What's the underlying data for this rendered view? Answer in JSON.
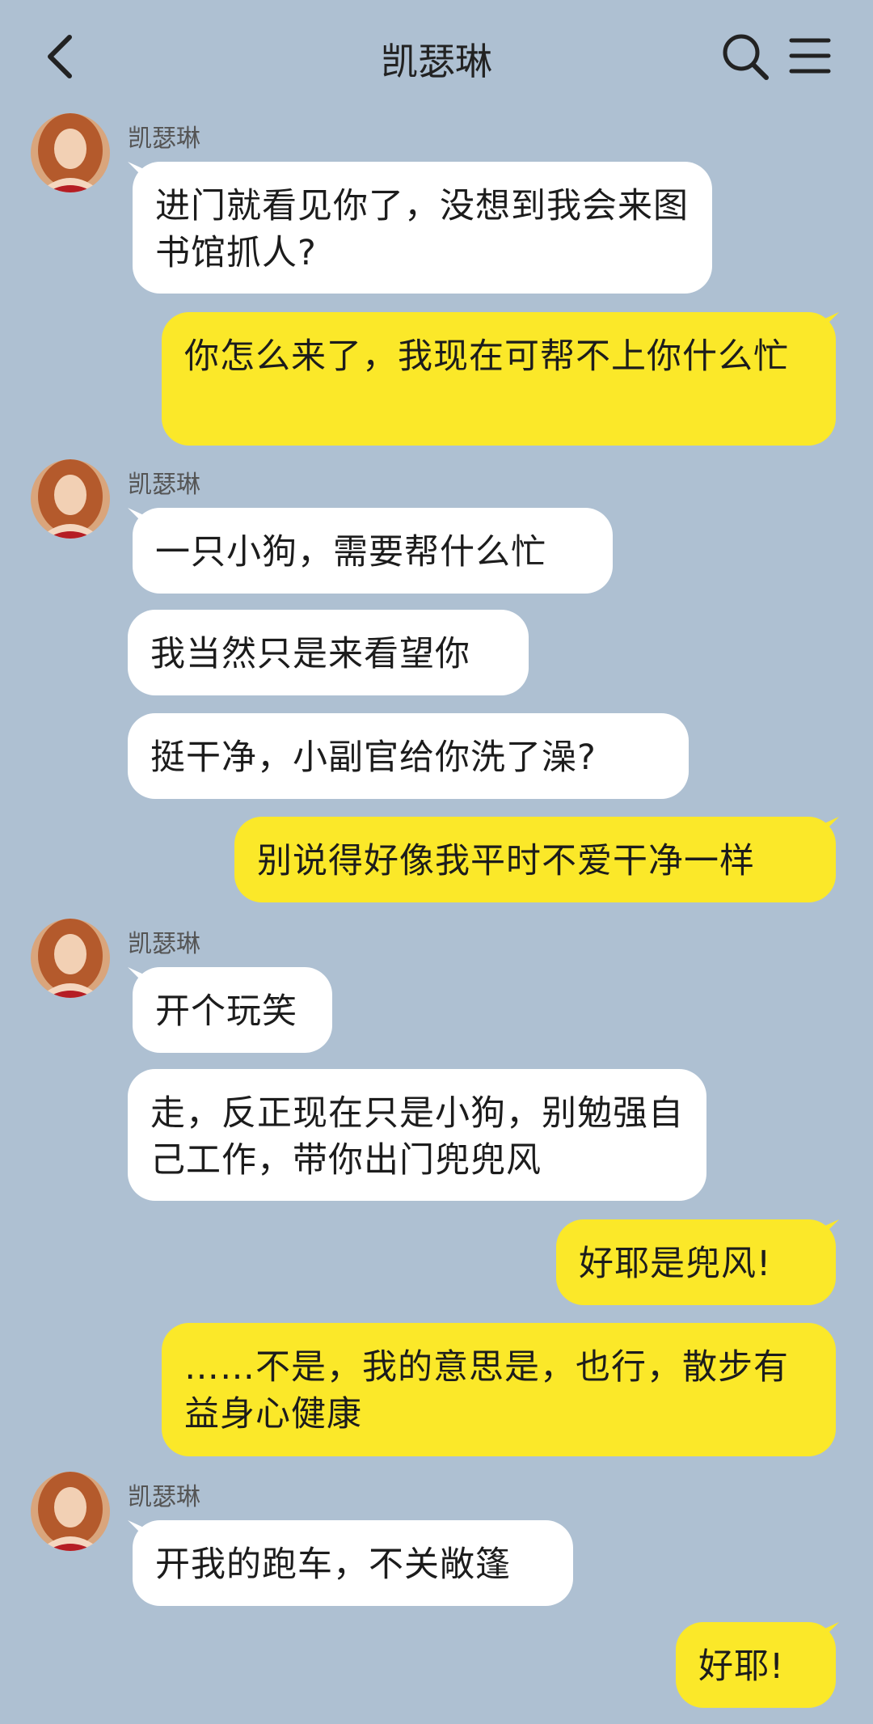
{
  "header": {
    "title": "凯瑟琳"
  },
  "colors": {
    "background": "#aec0d2",
    "incoming": "#ffffff",
    "outgoing": "#fbe829"
  },
  "icons": {
    "back": "chevron-left-icon",
    "search": "search-icon",
    "menu": "menu-icon"
  },
  "messages": [
    {
      "side": "in",
      "sender": "凯瑟琳",
      "text": "进门就看见你了，没想到我会来图书馆抓人?"
    },
    {
      "side": "out",
      "text": "你怎么来了，我现在可帮不上你什么忙"
    },
    {
      "side": "in",
      "sender": "凯瑟琳",
      "text": "一只小狗，需要帮什么忙"
    },
    {
      "side": "in",
      "text": "我当然只是来看望你"
    },
    {
      "side": "in",
      "text": "挺干净，小副官给你洗了澡?"
    },
    {
      "side": "out",
      "text": "别说得好像我平时不爱干净一样"
    },
    {
      "side": "in",
      "sender": "凯瑟琳",
      "text": "开个玩笑"
    },
    {
      "side": "in",
      "text": "走，反正现在只是小狗，别勉强自己工作，带你出门兜兜风"
    },
    {
      "side": "out",
      "text": "好耶是兜风!"
    },
    {
      "side": "out",
      "text": "……不是，我的意思是，也行，散步有益身心健康"
    },
    {
      "side": "in",
      "sender": "凯瑟琳",
      "text": "开我的跑车，不关敞篷"
    },
    {
      "side": "out",
      "text": "好耶!"
    }
  ]
}
